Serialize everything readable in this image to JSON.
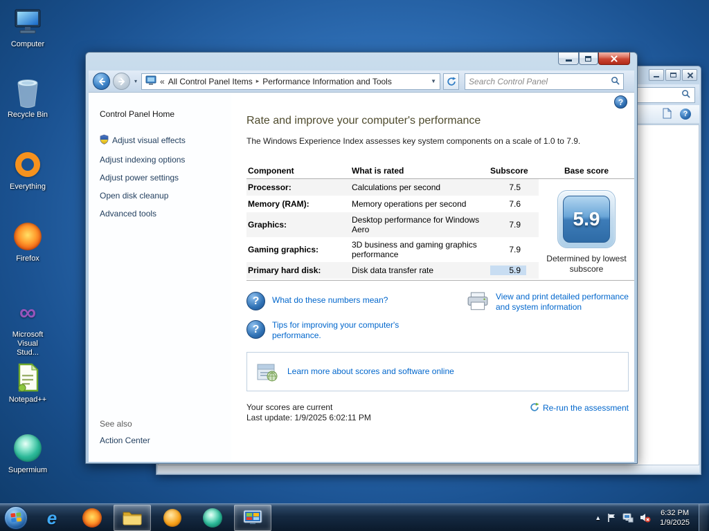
{
  "glyphs": {
    "question": "?",
    "collapse": "«",
    "separator": "▸",
    "dropdown": "▼",
    "nav_history": "▾",
    "tray_arrow": "▲",
    "ie": "e",
    "infinity": "∞"
  },
  "colors": {
    "link_blue": "#0066cc",
    "badge_blue": "#2e6ba6",
    "subscore_highlight": "#c8ddf2",
    "close_button_red": "#cc4632",
    "title_olive": "#4f4b2d"
  },
  "desktop": {
    "icons": [
      {
        "label": "Computer"
      },
      {
        "label": "Recycle Bin"
      },
      {
        "label": "Everything"
      },
      {
        "label": "Firefox"
      },
      {
        "label": "Microsoft Visual Stud..."
      },
      {
        "label": "Notepad++"
      },
      {
        "label": "Supermium"
      }
    ]
  },
  "main_window": {
    "breadcrumb": {
      "items": [
        "All Control Panel Items",
        "Performance Information and Tools"
      ]
    },
    "search": {
      "placeholder": "Search Control Panel"
    },
    "sidebar": {
      "home": "Control Panel Home",
      "tasks": [
        "Adjust visual effects",
        "Adjust indexing options",
        "Adjust power settings",
        "Open disk cleanup",
        "Advanced tools"
      ],
      "see_also": "See also",
      "see_also_links": [
        "Action Center"
      ]
    },
    "content": {
      "title": "Rate and improve your computer's performance",
      "subtitle": "The Windows Experience Index assesses key system components on a scale of 1.0 to 7.9.",
      "table": {
        "headers": [
          "Component",
          "What is rated",
          "Subscore",
          "Base score"
        ],
        "rows": [
          {
            "component": "Processor:",
            "rated": "Calculations per second",
            "subscore": "7.5"
          },
          {
            "component": "Memory (RAM):",
            "rated": "Memory operations per second",
            "subscore": "7.6"
          },
          {
            "component": "Graphics:",
            "rated": "Desktop performance for Windows Aero",
            "subscore": "7.9"
          },
          {
            "component": "Gaming graphics:",
            "rated": "3D business and gaming graphics performance",
            "subscore": "7.9"
          },
          {
            "component": "Primary hard disk:",
            "rated": "Disk data transfer rate",
            "subscore": "5.9"
          }
        ]
      },
      "base_score": {
        "value": "5.9",
        "caption": "Determined by lowest subscore"
      },
      "links": {
        "numbers": "What do these numbers mean?",
        "tips": "Tips for improving your computer's performance.",
        "print": "View and print detailed performance and system information",
        "learn": "Learn more about scores and software online",
        "rerun": "Re-run the assessment"
      },
      "status": {
        "line1": "Your scores are current",
        "line2": "Last update: 1/9/2025 6:02:11 PM"
      }
    }
  },
  "taskbar": {
    "clock": {
      "time": "6:32 PM",
      "date": "1/9/2025"
    }
  }
}
